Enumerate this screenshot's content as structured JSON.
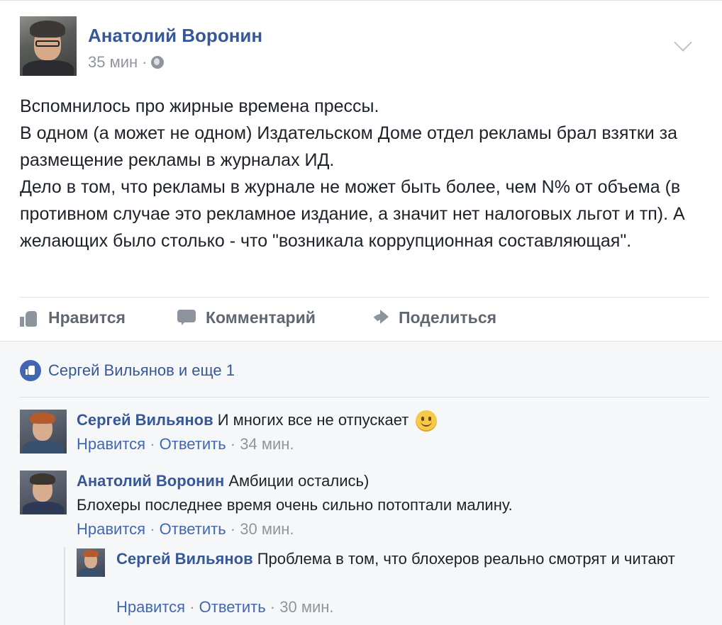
{
  "post": {
    "author": "Анатолий Воронин",
    "time": "35 мин",
    "dot": "·",
    "text_lines": [
      "Вспомнилось про жирные времена прессы.",
      "В одном (а может не одном) Издательском Доме отдел рекламы брал взятки за размещение рекламы в журналах ИД.",
      "Дело в том, что рекламы в журнале не может быть более, чем N% от объема (в противном случае это рекламное издание, а значит нет налоговых льгот и тп). А желающих было столько - что \"возникала коррупционная составляющая\"."
    ]
  },
  "actions": {
    "like": "Нравится",
    "comment": "Комментарий",
    "share": "Поделиться"
  },
  "likes_summary": "Сергей Вильянов и еще 1",
  "comments": [
    {
      "author": "Сергей Вильянов",
      "text": "И многих все не отпускает",
      "like": "Нравится",
      "reply": "Ответить",
      "time": "34 мин."
    },
    {
      "author": "Анатолий Воронин",
      "text": "Амбиции остались)",
      "text2": "Блохеры последнее время очень сильно потоптали малину.",
      "like": "Нравится",
      "reply": "Ответить",
      "time": "30 мин."
    },
    {
      "author": "Сергей Вильянов",
      "text": "Проблема в том, что блохеров реально смотрят и читают",
      "like": "Нравится",
      "reply": "Ответить",
      "time": "30 мин."
    }
  ],
  "sep": " · ",
  "icons": [
    "chevron-down-icon",
    "globe-icon",
    "like-icon",
    "comment-icon",
    "share-icon",
    "like-badge-icon",
    "smiley-icon"
  ],
  "colors": {
    "link": "#365899",
    "meta": "#90949c",
    "action": "#606770",
    "badge": "#4267b2"
  }
}
